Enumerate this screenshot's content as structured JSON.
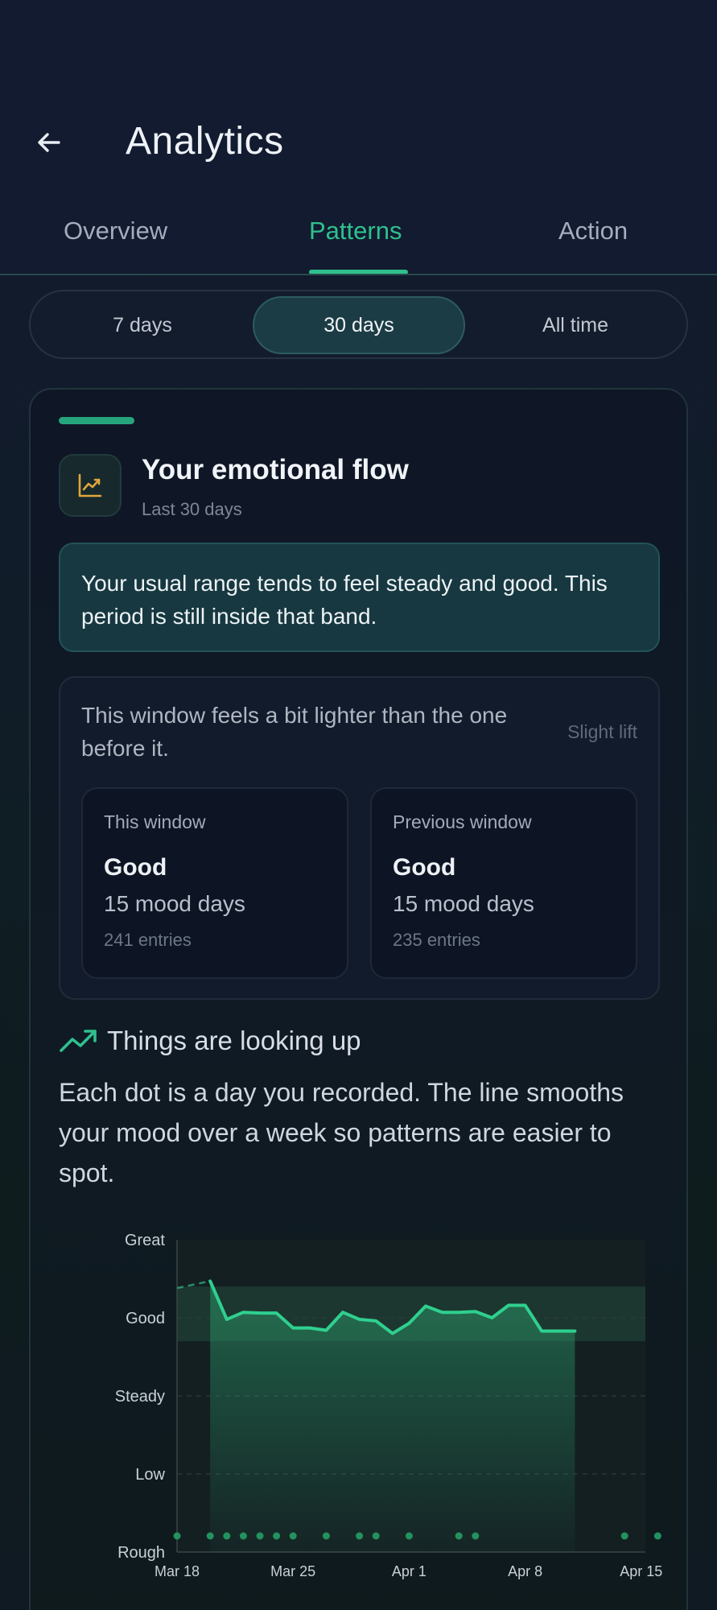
{
  "header": {
    "title": "Analytics",
    "back_icon": "arrow-left-icon"
  },
  "tabs": [
    {
      "label": "Overview",
      "active": false
    },
    {
      "label": "Patterns",
      "active": true
    },
    {
      "label": "Action",
      "active": false
    }
  ],
  "range": {
    "options": [
      "7 days",
      "30 days",
      "All time"
    ],
    "selected": "30 days"
  },
  "flow_card": {
    "icon": "trend-chart-icon",
    "title": "Your emotional flow",
    "subtitle": "Last 30 days",
    "insight": "Your usual range tends to feel steady and good. This period is still inside that band.",
    "comparison": {
      "text": "This window feels a bit lighter than the one before it.",
      "tag": "Slight lift",
      "this_window": {
        "label": "This window",
        "mood": "Good",
        "days": "15 mood days",
        "entries": "241 entries"
      },
      "previous_window": {
        "label": "Previous window",
        "mood": "Good",
        "days": "15 mood days",
        "entries": "235 entries"
      }
    },
    "trend": {
      "icon": "trending-up-icon",
      "label": "Things are looking up"
    },
    "description": "Each dot is a day you recorded. The line smooths your mood over a week so patterns are easier to spot."
  },
  "colors": {
    "accent": "#2fc08e",
    "background": "#111a2e",
    "insight_bg": "#173840",
    "icon_gold": "#e0a63a"
  },
  "chart_data": {
    "type": "line",
    "y_categories": [
      "Rough",
      "Low",
      "Steady",
      "Good",
      "Great"
    ],
    "x_tick_labels": [
      "Mar 18",
      "Mar 25",
      "Apr 1",
      "Apr 8",
      "Apr 15"
    ],
    "x_start": "Mar 18",
    "band": {
      "from": 3.7,
      "to": 4.4
    },
    "series": [
      {
        "style": "line",
        "x": [
          "Mar 20",
          "Mar 21",
          "Mar 22",
          "Mar 23",
          "Mar 24",
          "Mar 25",
          "Mar 26",
          "Mar 27",
          "Mar 28",
          "Mar 29",
          "Mar 30",
          "Mar 31",
          "Apr 1",
          "Apr 2",
          "Apr 3",
          "Apr 4",
          "Apr 5",
          "Apr 6",
          "Apr 7",
          "Apr 8",
          "Apr 9",
          "Apr 10",
          "Apr 11"
        ],
        "y": [
          4.47,
          3.98,
          4.07,
          4.06,
          4.06,
          3.87,
          3.87,
          3.84,
          4.07,
          3.98,
          3.96,
          3.8,
          3.93,
          4.15,
          4.07,
          4.07,
          4.08,
          4.0,
          4.16,
          4.16,
          3.83,
          3.83,
          3.83
        ]
      }
    ],
    "dashed_lead_in": {
      "x": [
        "Mar 18",
        "Mar 20"
      ],
      "y": [
        4.38,
        4.47
      ]
    },
    "recorded_days": [
      "Mar 18",
      "Mar 20",
      "Mar 21",
      "Mar 22",
      "Mar 23",
      "Mar 24",
      "Mar 25",
      "Mar 27",
      "Mar 29",
      "Mar 30",
      "Apr 1",
      "Apr 4",
      "Apr 5",
      "Apr 14",
      "Apr 16"
    ]
  }
}
